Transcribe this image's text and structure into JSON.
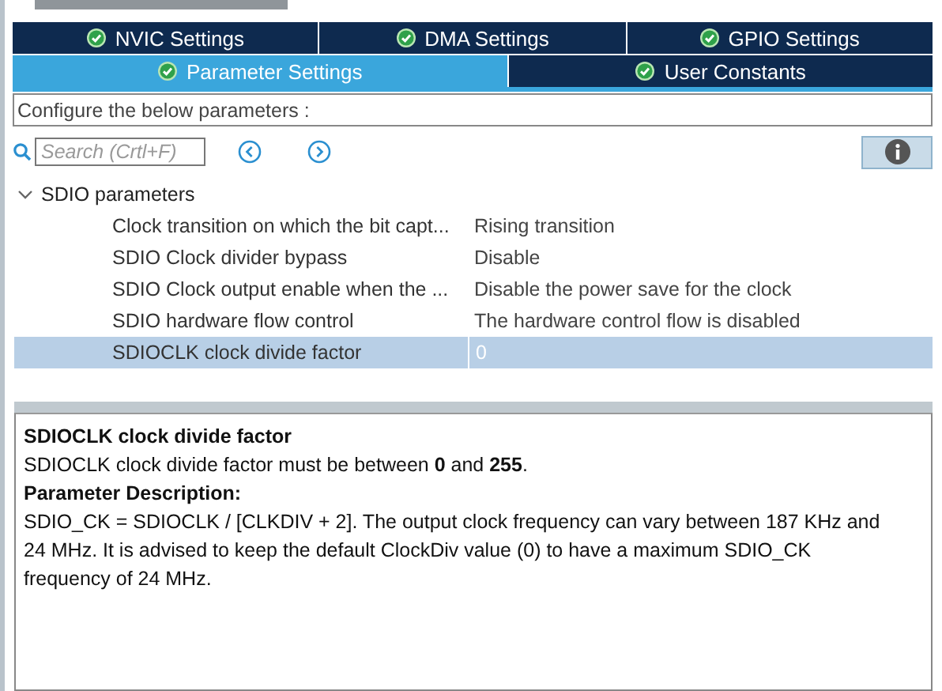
{
  "tabs_top": [
    {
      "label": "NVIC Settings",
      "selected": false
    },
    {
      "label": "DMA Settings",
      "selected": false
    },
    {
      "label": "GPIO Settings",
      "selected": false
    }
  ],
  "tabs_bottom": [
    {
      "label": "Parameter Settings",
      "selected": true
    },
    {
      "label": "User Constants",
      "selected": false
    }
  ],
  "configure_label": "Configure the below parameters :",
  "search": {
    "placeholder": "Search (Crtl+F)"
  },
  "tree": {
    "label": "SDIO parameters",
    "expanded": true,
    "children": [
      {
        "name": "Clock transition on which the bit capt...",
        "value": "Rising transition",
        "selected": false
      },
      {
        "name": "SDIO Clock divider bypass",
        "value": "Disable",
        "selected": false
      },
      {
        "name": "SDIO Clock output enable when the ...",
        "value": "Disable the power save for the clock",
        "selected": false
      },
      {
        "name": "SDIO hardware flow control",
        "value": "The hardware control flow is disabled",
        "selected": false
      },
      {
        "name": "SDIOCLK clock divide factor",
        "value": "0",
        "selected": true
      }
    ]
  },
  "description": {
    "title": "SDIOCLK clock divide factor",
    "range": "SDIOCLK clock divide factor must be between **0** and **255**.",
    "heading": "Parameter Description:",
    "body": "SDIO_CK = SDIOCLK / [CLKDIV + 2]. The output clock frequency can vary between 187 KHz and 24 MHz. It is advised to keep the default ClockDiv value (0) to have a maximum SDIO_CK frequency of 24 MHz."
  }
}
